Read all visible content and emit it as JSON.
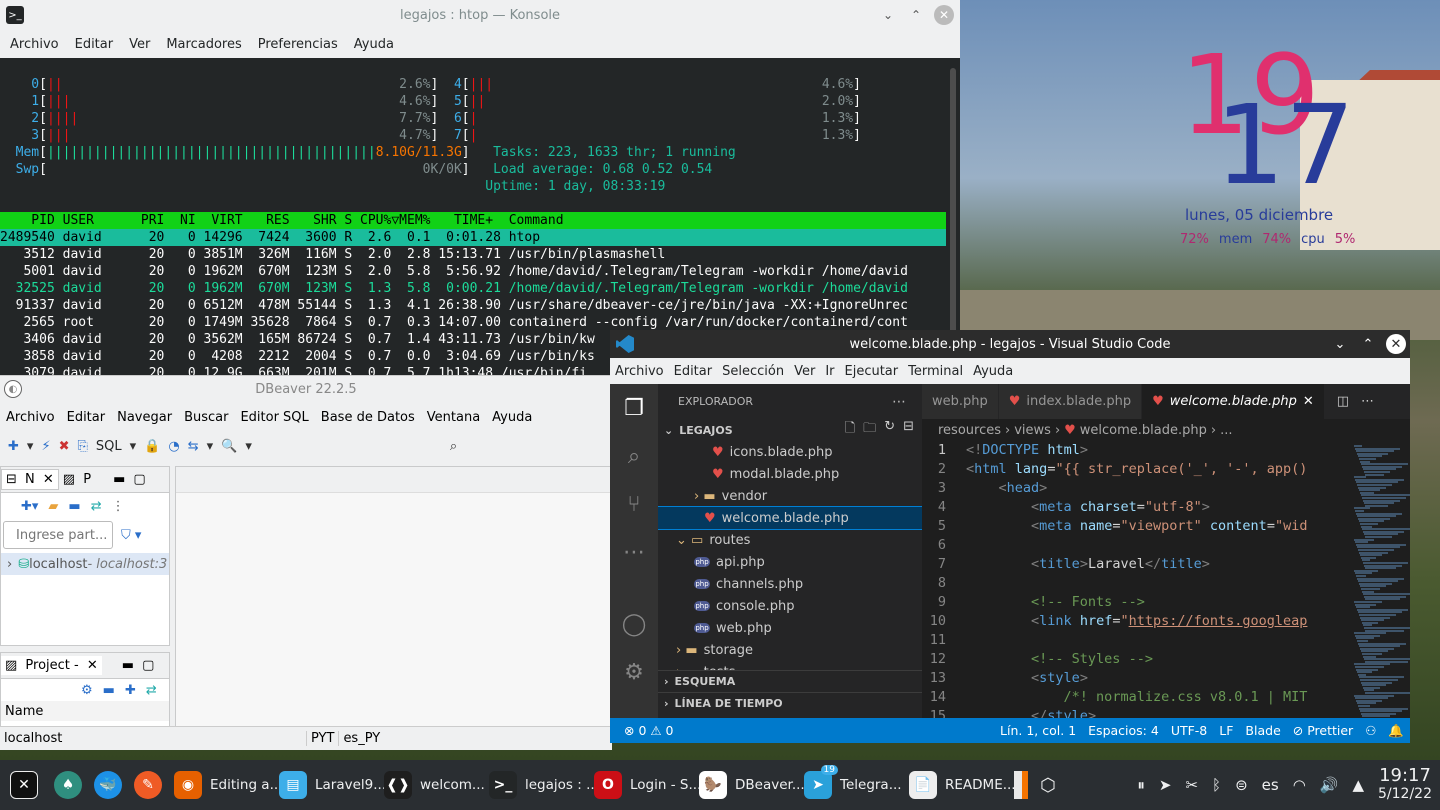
{
  "konsole": {
    "title": "legajos : htop — Konsole",
    "menu": [
      "Archivo",
      "Editar",
      "Ver",
      "Marcadores",
      "Preferencias",
      "Ayuda"
    ],
    "cpus": [
      {
        "id": "0",
        "bars": "||",
        "pct": "2.6%"
      },
      {
        "id": "1",
        "bars": "|||",
        "pct": "4.6%"
      },
      {
        "id": "2",
        "bars": "||||",
        "pct": "7.7%"
      },
      {
        "id": "3",
        "bars": "|||",
        "pct": "4.7%"
      },
      {
        "id": "4",
        "bars": "|||",
        "pct": "4.6%"
      },
      {
        "id": "5",
        "bars": "||",
        "pct": "2.0%"
      },
      {
        "id": "6",
        "bars": "|",
        "pct": "1.3%"
      },
      {
        "id": "7",
        "bars": "|",
        "pct": "1.3%"
      }
    ],
    "mem_bars": "||||||||||||||||||||||||||||||||||||||||||",
    "mem_value": "8.10G/11.3G",
    "swp_value": "0K/0K",
    "tasks_line": "Tasks: 223, 1633 thr; 1 running",
    "load_line": "Load average: 0.68 0.52 0.54",
    "uptime_line": "Uptime: 1 day, 08:33:19",
    "header": "    PID USER      PRI  NI  VIRT   RES   SHR S CPU%▽MEM%   TIME+  Command",
    "processes": [
      "2489540 david      20   0 14296  7424  3600 R  2.6  0.1  0:01.28 htop",
      "   3512 david      20   0 3851M  326M  116M S  2.0  2.8 15:13.71 /usr/bin/plasmashell",
      "   5001 david      20   0 1962M  670M  123M S  2.0  5.8  5:56.92 /home/david/.Telegram/Telegram -workdir /home/david",
      "  32525 david      20   0 1962M  670M  123M S  1.3  5.8  0:00.21 /home/david/.Telegram/Telegram -workdir /home/david",
      "  91337 david      20   0 6512M  478M 55144 S  1.3  4.1 26:38.90 /usr/share/dbeaver-ce/jre/bin/java -XX:+IgnoreUnrec",
      "   2565 root       20   0 1749M 35628  7864 S  0.7  0.3 14:07.00 containerd --config /var/run/docker/containerd/cont",
      "   3406 david      20   0 3562M  165M 86724 S  0.7  1.4 43:11.73 /usr/bin/kw",
      "   3858 david      20   0  4208  2212  2004 S  0.7  0.0  3:04.69 /usr/bin/ks",
      "   3079 david      20   0 12.9G  663M  201M S  0.7  5.7 1h13:48 /usr/bin/fi"
    ]
  },
  "dbeaver": {
    "title": "DBeaver 22.2.5",
    "menu": [
      "Archivo",
      "Editar",
      "Navegar",
      "Buscar",
      "Editor SQL",
      "Base de Datos",
      "Ventana",
      "Ayuda"
    ],
    "sql_label": "SQL",
    "nav_tab": "N",
    "proj_tab": "P",
    "filter_placeholder": "Ingrese part...",
    "connection_name": "localhost",
    "connection_host": " - localhost:3",
    "project_tab": "Project -",
    "name_col": "Name",
    "status_left": "localhost",
    "status_tz": "PYT",
    "status_locale": "es_PY"
  },
  "vscode": {
    "title": "welcome.blade.php - legajos - Visual Studio Code",
    "menu": [
      "Archivo",
      "Editar",
      "Selección",
      "Ver",
      "Ir",
      "Ejecutar",
      "Terminal",
      "Ayuda"
    ],
    "explorer_label": "EXPLORADOR",
    "project_label": "LEGAJOS",
    "tree": [
      {
        "name": "icons.blade.php",
        "type": "blade",
        "indent": 54
      },
      {
        "name": "modal.blade.php",
        "type": "blade",
        "indent": 54
      },
      {
        "name": "vendor",
        "type": "folder",
        "indent": 36
      },
      {
        "name": "welcome.blade.php",
        "type": "blade",
        "indent": 46
      },
      {
        "name": "routes",
        "type": "folder-open",
        "indent": 18
      },
      {
        "name": "api.php",
        "type": "php",
        "indent": 36
      },
      {
        "name": "channels.php",
        "type": "php",
        "indent": 36
      },
      {
        "name": "console.php",
        "type": "php",
        "indent": 36
      },
      {
        "name": "web.php",
        "type": "php",
        "indent": 36
      },
      {
        "name": "storage",
        "type": "folder",
        "indent": 18
      },
      {
        "name": "tests",
        "type": "folder",
        "indent": 18
      }
    ],
    "outline_label": "ESQUEMA",
    "timeline_label": "LÍNEA DE TIEMPO",
    "tabs": [
      "web.php",
      "index.blade.php",
      "welcome.blade.php"
    ],
    "breadcrumbs": [
      "resources",
      "views",
      "welcome.blade.php",
      "..."
    ],
    "code": [
      {
        "n": "1",
        "html": "<span class='tg'>&lt;!</span><span class='tn'>DOCTYPE</span> <span class='at'>html</span><span class='tg'>&gt;</span>"
      },
      {
        "n": "2",
        "html": "<span class='tg'>&lt;</span><span class='tn'>html</span> <span class='at'>lang</span><span class='tx'>=</span><span class='st'>\"{{ str_replace('_', '-', app()</span>"
      },
      {
        "n": "3",
        "html": "    <span class='tg'>&lt;</span><span class='tn'>head</span><span class='tg'>&gt;</span>"
      },
      {
        "n": "4",
        "html": "        <span class='tg'>&lt;</span><span class='tn'>meta</span> <span class='at'>charset</span><span class='tx'>=</span><span class='st'>\"utf-8\"</span><span class='tg'>&gt;</span>"
      },
      {
        "n": "5",
        "html": "        <span class='tg'>&lt;</span><span class='tn'>meta</span> <span class='at'>name</span><span class='tx'>=</span><span class='st'>\"viewport\"</span> <span class='at'>content</span><span class='tx'>=</span><span class='st'>\"wid</span>"
      },
      {
        "n": "6",
        "html": ""
      },
      {
        "n": "7",
        "html": "        <span class='tg'>&lt;</span><span class='tn'>title</span><span class='tg'>&gt;</span><span class='tx'>Laravel</span><span class='tg'>&lt;/</span><span class='tn'>title</span><span class='tg'>&gt;</span>"
      },
      {
        "n": "8",
        "html": ""
      },
      {
        "n": "9",
        "html": "        <span class='cm'>&lt;!-- Fonts --&gt;</span>"
      },
      {
        "n": "10",
        "html": "        <span class='tg'>&lt;</span><span class='tn'>link</span> <span class='at'>href</span><span class='tx'>=</span><span class='st'>\"<u>https://fonts.googleap</u></span>"
      },
      {
        "n": "11",
        "html": ""
      },
      {
        "n": "12",
        "html": "        <span class='cm'>&lt;!-- Styles --&gt;</span>"
      },
      {
        "n": "13",
        "html": "        <span class='tg'>&lt;</span><span class='tn'>style</span><span class='tg'>&gt;</span>"
      },
      {
        "n": "14",
        "html": "            <span class='cm'>/*! normalize.css v8.0.1 | MIT</span>"
      },
      {
        "n": "15",
        "html": "        <span class='tg'>&lt;/</span><span class='tn'>style</span><span class='tg'>&gt;</span>"
      }
    ],
    "status": {
      "problems": "⊗ 0 ⚠ 0",
      "position": "Lín. 1, col. 1",
      "spaces": "Espacios: 4",
      "encoding": "UTF-8",
      "eol": "LF",
      "language": "Blade",
      "prettier": "⊘ Prettier"
    }
  },
  "desktop_clock": {
    "day1": "19",
    "day2": "17",
    "date": "lunes, 05 diciembre",
    "mem_pct": "72%",
    "mem_label": "mem",
    "cpu_pct": "74%",
    "cpu_label": "cpu",
    "other_pct": "5%"
  },
  "taskbar": {
    "apps": [
      {
        "label": "Editing a...",
        "color": "#e66000",
        "glyph": "◉"
      },
      {
        "label": "Laravel9...",
        "color": "#3daee9",
        "glyph": "▤"
      },
      {
        "label": "welcom...",
        "color": "#1e1e1e",
        "glyph": "❰❱"
      },
      {
        "label": "legajos : ...",
        "color": "#232627",
        "glyph": ">_"
      },
      {
        "label": "Login - S...",
        "color": "#cc0f16",
        "glyph": "O"
      },
      {
        "label": "DBeaver...",
        "color": "#ffffff",
        "glyph": "🦫"
      },
      {
        "label": "Telegra...",
        "color": "#2aa1da",
        "glyph": "➤"
      },
      {
        "label": "README...",
        "color": "#eeeeee",
        "glyph": "📄"
      }
    ],
    "telegram_badge": "19",
    "keyboard_layout": "es",
    "time": "19:17",
    "date": "5/12/22"
  },
  "colors": {
    "accent": "#007acc",
    "htop_header": "#11d116",
    "htop_select": "#1abc9c"
  }
}
